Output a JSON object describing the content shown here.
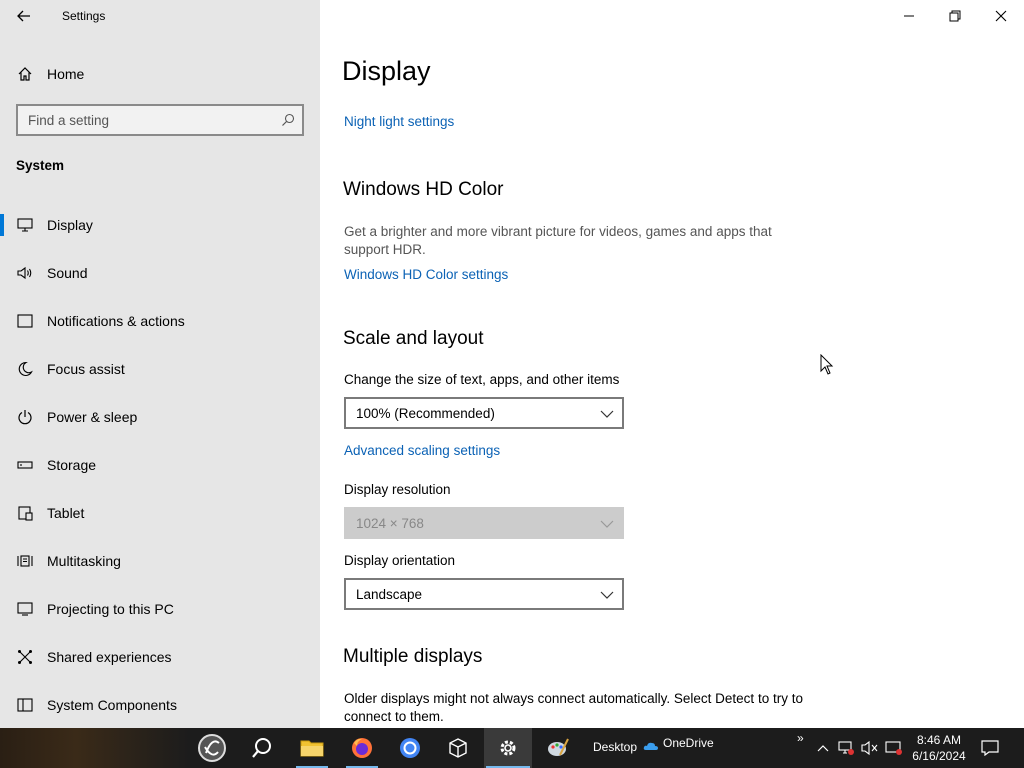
{
  "window": {
    "app_title": "Settings"
  },
  "sidebar": {
    "home_label": "Home",
    "search_placeholder": "Find a setting",
    "section": "System",
    "items": [
      {
        "label": "Display",
        "icon": "monitor-icon",
        "active": true
      },
      {
        "label": "Sound",
        "icon": "speaker-icon"
      },
      {
        "label": "Notifications & actions",
        "icon": "notification-icon"
      },
      {
        "label": "Focus assist",
        "icon": "moon-icon"
      },
      {
        "label": "Power & sleep",
        "icon": "power-icon"
      },
      {
        "label": "Storage",
        "icon": "storage-icon"
      },
      {
        "label": "Tablet",
        "icon": "tablet-icon"
      },
      {
        "label": "Multitasking",
        "icon": "multitasking-icon"
      },
      {
        "label": "Projecting to this PC",
        "icon": "projecting-icon"
      },
      {
        "label": "Shared experiences",
        "icon": "shared-icon"
      },
      {
        "label": "System Components",
        "icon": "components-icon"
      }
    ]
  },
  "main": {
    "title": "Display",
    "night_light_link": "Night light settings",
    "hd_color": {
      "heading": "Windows HD Color",
      "description": "Get a brighter and more vibrant picture for videos, games and apps that support HDR.",
      "link": "Windows HD Color settings"
    },
    "scale_layout": {
      "heading": "Scale and layout",
      "scale_label": "Change the size of text, apps, and other items",
      "scale_value": "100% (Recommended)",
      "advanced_link": "Advanced scaling settings",
      "resolution_label": "Display resolution",
      "resolution_value": "1024 × 768",
      "orientation_label": "Display orientation",
      "orientation_value": "Landscape"
    },
    "multiple_displays": {
      "heading": "Multiple displays",
      "description": "Older displays might not always connect automatically. Select Detect to try to connect to them."
    }
  },
  "taskbar": {
    "desktop_label": "Desktop",
    "onedrive_label": "OneDrive",
    "time": "8:46 AM",
    "date": "6/16/2024"
  },
  "colors": {
    "accent": "#0078d7",
    "link": "#0b62b5",
    "sidebar_bg": "#e6e6e6",
    "taskbar_bg": "#1c1c1c"
  }
}
